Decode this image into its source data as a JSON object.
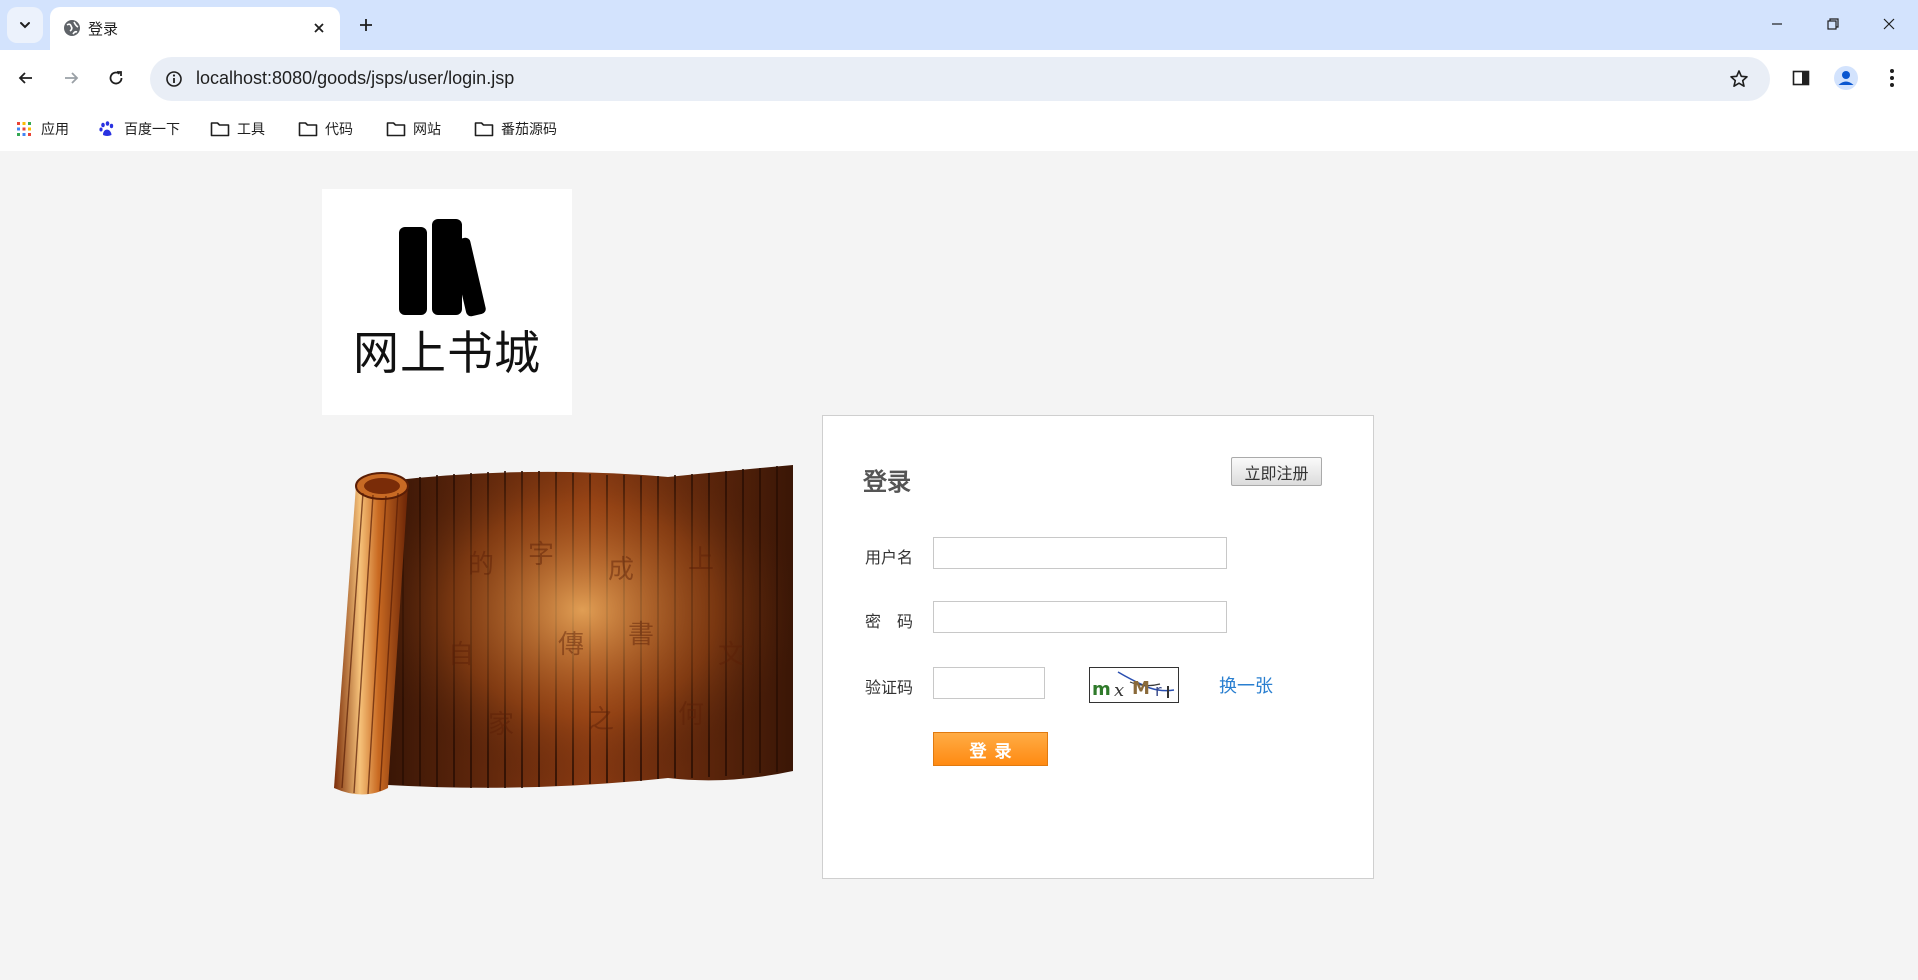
{
  "browser": {
    "tab": {
      "title": "登录"
    },
    "url": "localhost:8080/goods/jsps/user/login.jsp",
    "bookmarks": [
      {
        "label": "应用",
        "icon": "apps-grid-icon"
      },
      {
        "label": "百度一下",
        "icon": "baidu-paw-icon"
      },
      {
        "label": "工具",
        "icon": "folder-icon"
      },
      {
        "label": "代码",
        "icon": "folder-icon"
      },
      {
        "label": "网站",
        "icon": "folder-icon"
      },
      {
        "label": "番茄源码",
        "icon": "folder-icon"
      }
    ]
  },
  "logo": {
    "text": "网上书城"
  },
  "login": {
    "title": "登录",
    "register_label": "立即注册",
    "username_label": "用户名",
    "username_value": "",
    "password_label": "密　码",
    "password_value": "",
    "verify_label": "验证码",
    "verify_value": "",
    "captcha_text": "m x M r",
    "refresh_label": "换一张",
    "submit_label": "登录"
  },
  "colors": {
    "accent_orange": "#ff8a12",
    "link_blue": "#2a7fd0",
    "tabstrip": "#d3e3fd"
  }
}
